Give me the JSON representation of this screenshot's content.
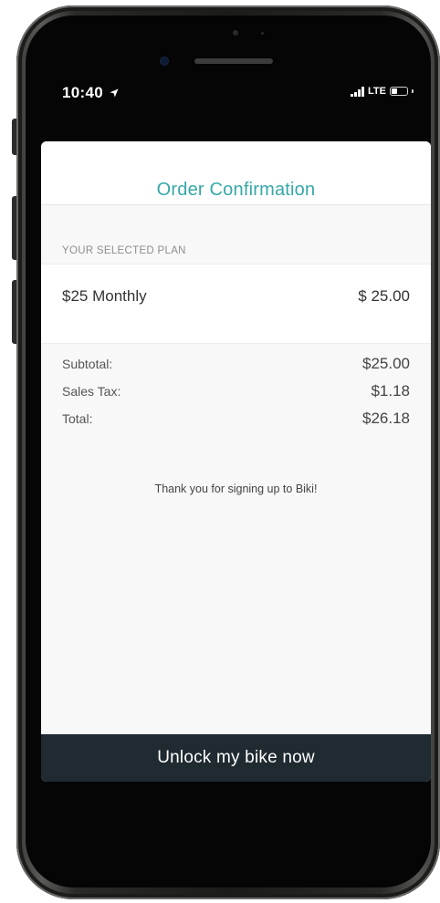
{
  "status_bar": {
    "time": "10:40",
    "location_icon": "location-arrow-icon",
    "network": "LTE",
    "battery_level": 0.35
  },
  "screen": {
    "title": "Order Confirmation",
    "plan_section_label": "YOUR SELECTED PLAN",
    "plan": {
      "name": "$25 Monthly",
      "price": "$ 25.00"
    },
    "summary": [
      {
        "label": "Subtotal:",
        "value": "$25.00"
      },
      {
        "label": "Sales Tax:",
        "value": "$1.18"
      },
      {
        "label": "Total:",
        "value": "$26.18"
      }
    ],
    "thank_you_message": "Thank you for signing up to Biki!",
    "primary_button_label": "Unlock my bike now"
  },
  "colors": {
    "accent": "#36a8a7",
    "button_background": "#1f2a31",
    "sheet_background": "#f8f8f8"
  }
}
